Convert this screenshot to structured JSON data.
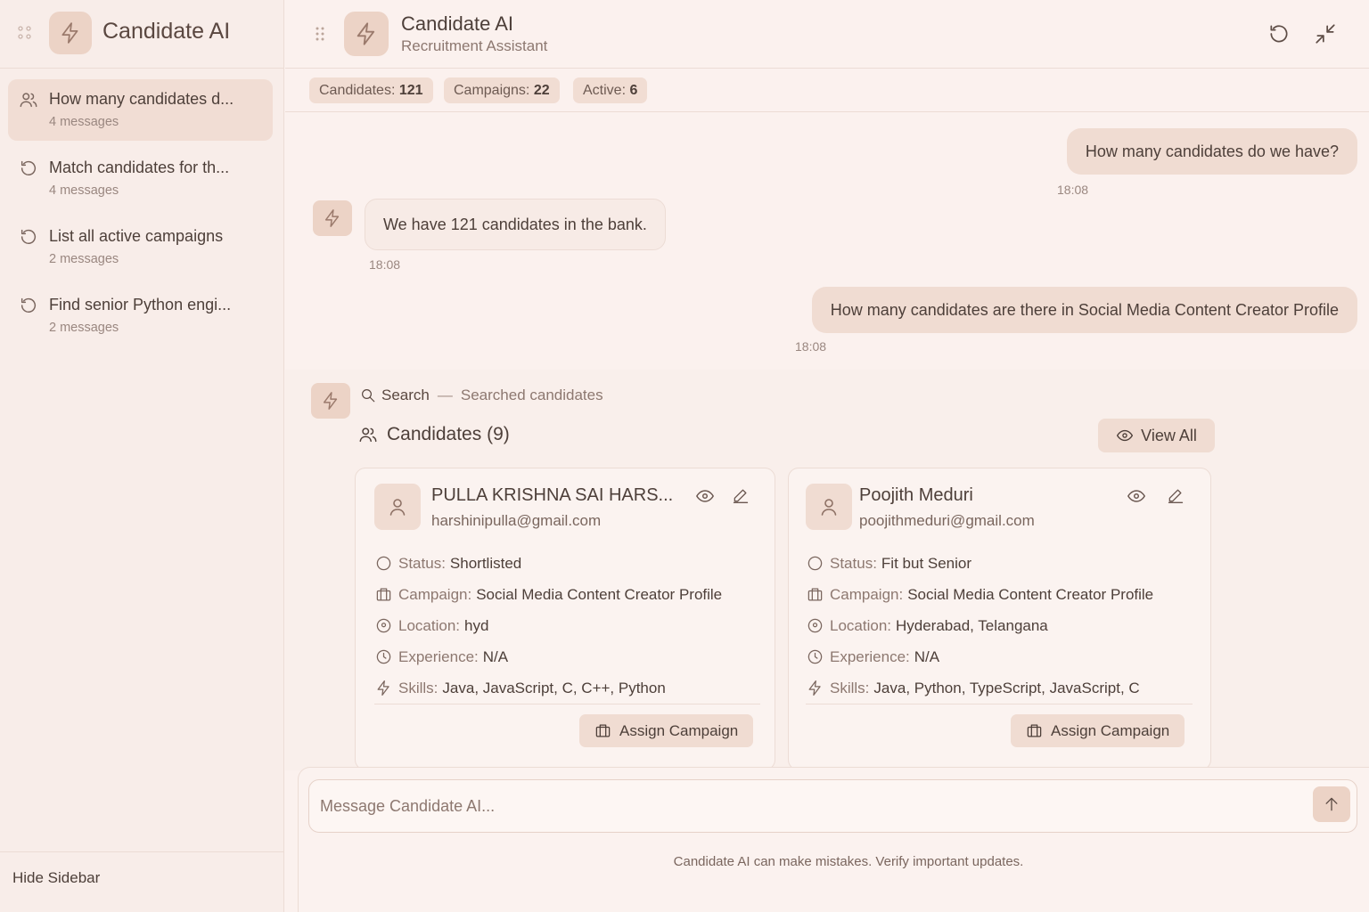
{
  "app": {
    "name": "Candidate AI",
    "subtitle": "Recruitment Assistant"
  },
  "sidebar": {
    "title": "Candidate AI",
    "conversations": [
      {
        "title": "How many candidates d...",
        "meta": "4 messages",
        "icon": "users-icon",
        "active": true
      },
      {
        "title": "Match candidates for th...",
        "meta": "4 messages",
        "icon": "history-icon"
      },
      {
        "title": "List all active campaigns",
        "meta": "2 messages",
        "icon": "history-icon"
      },
      {
        "title": "Find senior Python engi...",
        "meta": "2 messages",
        "icon": "history-icon"
      }
    ],
    "hide_label": "Hide Sidebar"
  },
  "stats": [
    {
      "label": "Candidates:",
      "value": "121"
    },
    {
      "label": "Campaigns:",
      "value": "22"
    },
    {
      "label": "Active:",
      "value": "6"
    }
  ],
  "messages": [
    {
      "role": "user",
      "text": "How many candidates do we have?",
      "time": "18:08"
    },
    {
      "role": "assistant",
      "text": "We have 121 candidates in the bank.",
      "time": "18:08"
    },
    {
      "role": "user",
      "text": "How many candidates are there in Social Media Content Creator Profile",
      "time": "18:08"
    }
  ],
  "tool": {
    "name": "Search",
    "separator": "—",
    "description": "Searched candidates",
    "results_title": "Candidates (9)",
    "view_all": "View All"
  },
  "candidates": [
    {
      "name": "PULLA KRISHNA SAI HARS...",
      "email": "harshinipulla@gmail.com",
      "status_label": "Status:",
      "status": "Shortlisted",
      "campaign_label": "Campaign:",
      "campaign": "Social Media Content Creator Profile",
      "location_label": "Location:",
      "location": "hyd",
      "experience_label": "Experience:",
      "experience": "N/A",
      "skills_label": "Skills:",
      "skills": "Java, JavaScript, C, C++, Python",
      "assign_label": "Assign Campaign"
    },
    {
      "name": "Poojith Meduri",
      "email": "poojithmeduri@gmail.com",
      "status_label": "Status:",
      "status": "Fit but Senior",
      "campaign_label": "Campaign:",
      "campaign": "Social Media Content Creator Profile",
      "location_label": "Location:",
      "location": "Hyderabad, Telangana",
      "experience_label": "Experience:",
      "experience": "N/A",
      "skills_label": "Skills:",
      "skills": "Java, Python, TypeScript, JavaScript, C",
      "assign_label": "Assign Campaign"
    }
  ],
  "composer": {
    "placeholder": "Message Candidate AI..."
  },
  "disclaimer": "Candidate AI can make mistakes. Verify important updates.",
  "colors": {
    "background": "#fbf1ee",
    "accent": "#ecd3c6",
    "text": "#4d3f39",
    "muted": "#8d7870"
  }
}
